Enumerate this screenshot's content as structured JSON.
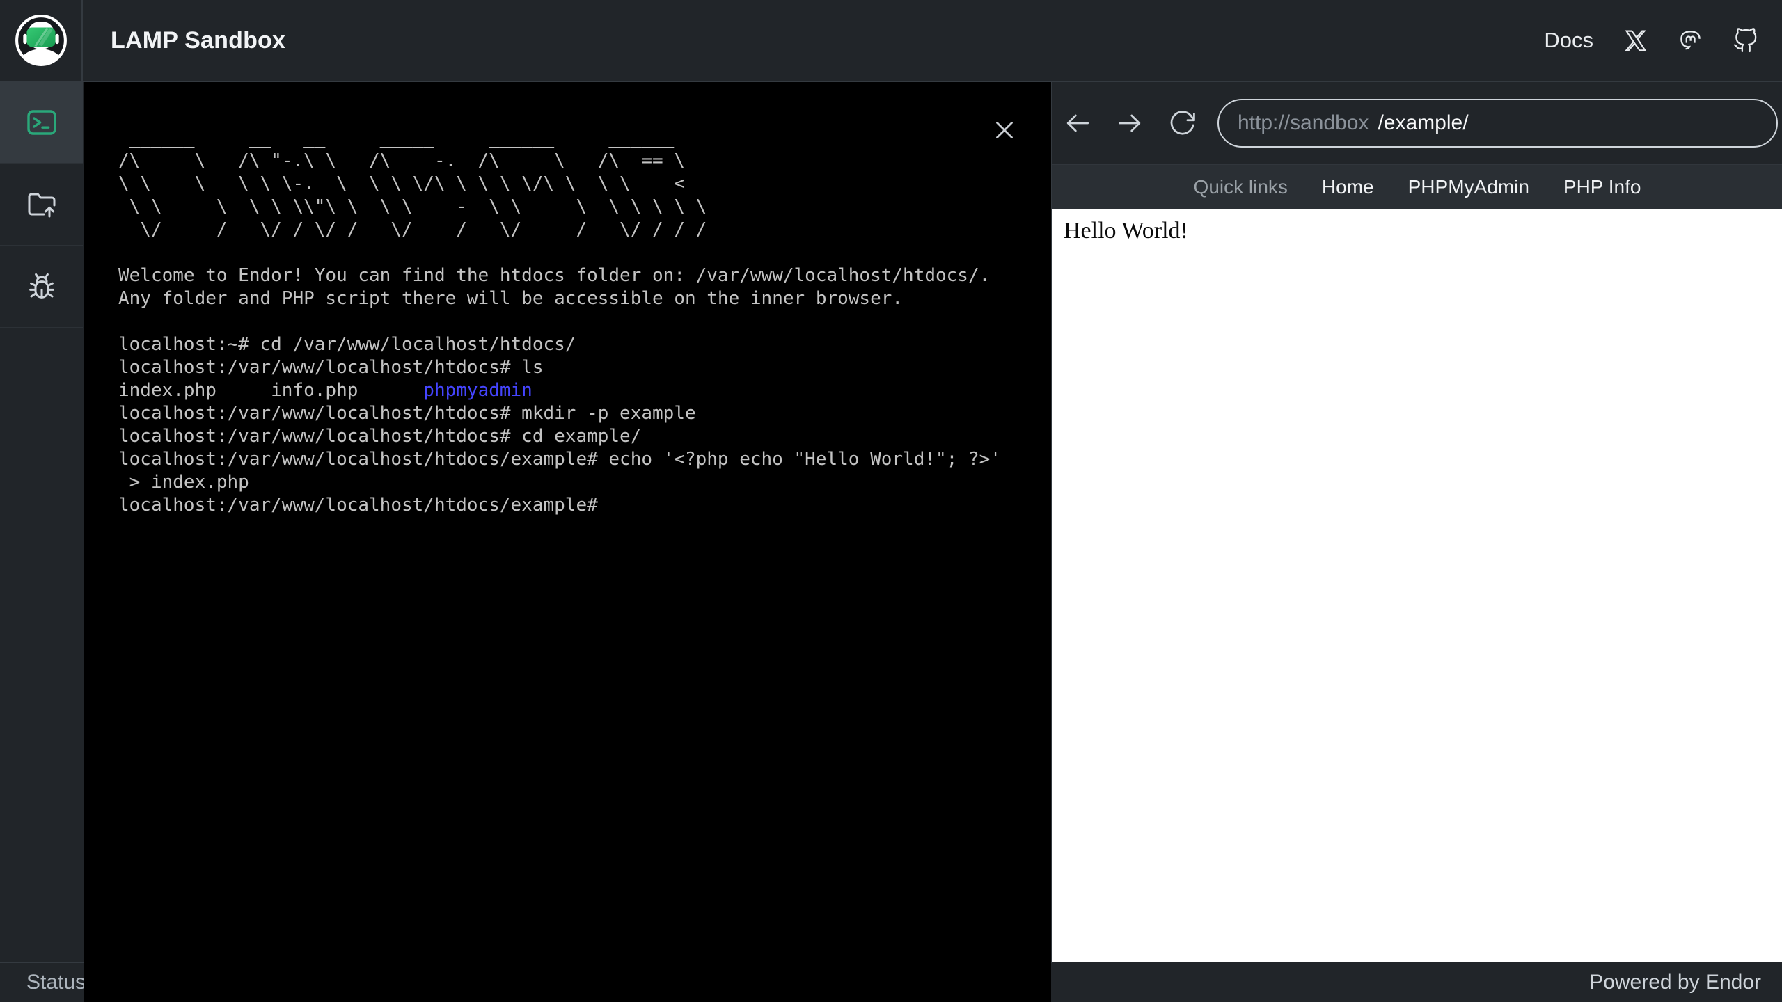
{
  "app": {
    "title": "LAMP Sandbox",
    "docs_label": "Docs"
  },
  "colors": {
    "topbar_bg": "#212529",
    "sidebar_active_bg": "#343a40",
    "accent_green": "#2aa87a",
    "terminal_bg": "#000000",
    "terminal_text": "#c3c3c3",
    "terminal_dir_blue": "#4545ff",
    "content_bg": "#ffffff",
    "divider": "#343a40"
  },
  "sidebar": {
    "items": [
      {
        "id": "terminal",
        "icon": "terminal-icon",
        "active": true
      },
      {
        "id": "upload",
        "icon": "folder-upload-icon",
        "active": false
      },
      {
        "id": "debug",
        "icon": "bug-icon",
        "active": false
      }
    ]
  },
  "terminal": {
    "close_label": "close",
    "lines": [
      [
        {
          "t": " ______     __   __     _____     ______     ______"
        }
      ],
      [
        {
          "t": "/\\  ___\\   /\\ \"-.\\ \\   /\\  __-.  /\\  __ \\   /\\  == \\"
        }
      ],
      [
        {
          "t": "\\ \\  __\\   \\ \\ \\-.  \\  \\ \\ \\/\\ \\ \\ \\ \\/\\ \\  \\ \\  __<"
        }
      ],
      [
        {
          "t": " \\ \\_____\\  \\ \\_\\\\\"\\_\\  \\ \\____-  \\ \\_____\\  \\ \\_\\ \\_\\"
        }
      ],
      [
        {
          "t": "  \\/_____/   \\/_/ \\/_/   \\/____/   \\/_____/   \\/_/ /_/"
        }
      ],
      [
        {
          "t": ""
        }
      ],
      [
        {
          "t": "Welcome to Endor! You can find the htdocs folder on: /var/www/localhost/htdocs/."
        }
      ],
      [
        {
          "t": "Any folder and PHP script there will be accessible on the inner browser."
        }
      ],
      [
        {
          "t": ""
        }
      ],
      [
        {
          "t": "localhost:~# cd /var/www/localhost/htdocs/"
        }
      ],
      [
        {
          "t": "localhost:/var/www/localhost/htdocs# ls"
        }
      ],
      [
        {
          "t": "index.php     info.php      "
        },
        {
          "t": "phpmyadmin",
          "c": "dir"
        }
      ],
      [
        {
          "t": "localhost:/var/www/localhost/htdocs# mkdir -p example"
        }
      ],
      [
        {
          "t": "localhost:/var/www/localhost/htdocs# cd example/"
        }
      ],
      [
        {
          "t": "localhost:/var/www/localhost/htdocs/example# echo '<?php echo \"Hello World!\"; ?>'"
        }
      ],
      [
        {
          "t": " > index.php"
        }
      ],
      [
        {
          "t": "localhost:/var/www/localhost/htdocs/example#"
        }
      ]
    ]
  },
  "browser": {
    "url_prefix": "http://sandbox",
    "url_value": "/example/",
    "quick_links_label": "Quick links",
    "links": [
      "Home",
      "PHPMyAdmin",
      "PHP Info"
    ],
    "content_text": "Hello World!"
  },
  "status_bar": {
    "left": "Status:",
    "right": "Powered by Endor"
  }
}
